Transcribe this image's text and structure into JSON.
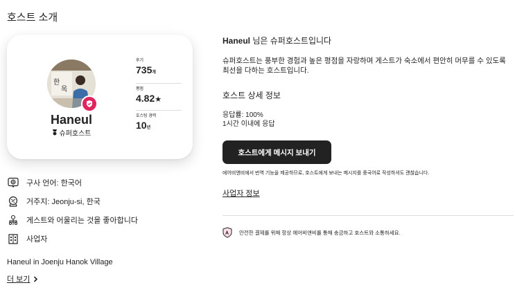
{
  "section_title": "호스트 소개",
  "profile": {
    "name": "Haneul",
    "role": "슈퍼호스트",
    "stats": [
      {
        "label": "후기",
        "value": "735",
        "unit": "개"
      },
      {
        "label": "평점",
        "value": "4.82",
        "unit": "★"
      },
      {
        "label": "호스팅 경력",
        "value": "10",
        "unit": "년"
      }
    ]
  },
  "info": {
    "language": "구사 언어: 한국어",
    "residence": "거주지: Jeonju-si, 한국",
    "likes": "게스트와 어울리는 것을 좋아합니다",
    "business": "사업자"
  },
  "bio": "Haneul in Joenju Hanok Village",
  "more_label": "더 보기",
  "right": {
    "super_name": "Haneul",
    "super_suffix": " 님은 슈퍼호스트입니다",
    "super_desc": "슈퍼호스트는 풍부한 경험과 높은 평점을 자랑하며 게스트가 숙소에서 편안히 머무를 수 있도록 최선을 다하는 호스트입니다.",
    "detail_title": "호스트 상세 정보",
    "response_rate": "응답률: 100%",
    "response_time": "1시간 이내에 응답",
    "message_button": "호스트에게 메시지 보내기",
    "translate_note": "에어비앤비에서 번역 기능을 제공하므로, 호스트에게 보내는 메시지를 중국어로 작성하셔도 괜찮습니다.",
    "business_link": "사업자 정보",
    "safety_note": "안전한 결제를 위해 항상 에어비앤비를 통해 송금하고 호스트와 소통하세요."
  },
  "colors": {
    "badge": "#e0245e",
    "button_bg": "#222222",
    "text": "#222222"
  }
}
